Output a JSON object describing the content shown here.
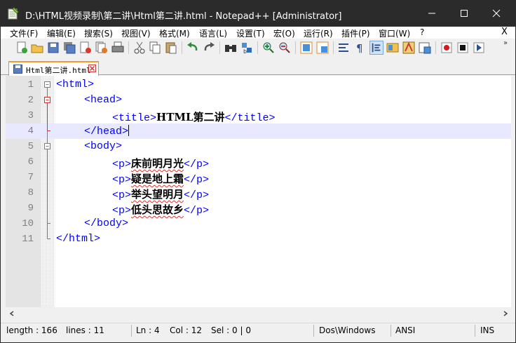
{
  "window": {
    "title": "D:\\HTML视频录制\\第二讲\\Html第二讲.html - Notepad++ [Administrator]"
  },
  "menu": {
    "items": [
      {
        "label": "文件(F)"
      },
      {
        "label": "编辑(E)"
      },
      {
        "label": "搜索(S)"
      },
      {
        "label": "视图(V)"
      },
      {
        "label": "格式(M)"
      },
      {
        "label": "语言(L)"
      },
      {
        "label": "设置(T)"
      },
      {
        "label": "宏(O)"
      },
      {
        "label": "运行(R)"
      },
      {
        "label": "插件(P)"
      },
      {
        "label": "窗口(W)"
      },
      {
        "label": "?"
      }
    ],
    "close_label": "X"
  },
  "toolbar": {
    "buttons": [
      "new-file-icon",
      "open-file-icon",
      "save-icon",
      "save-all-icon",
      "close-icon",
      "close-all-icon",
      "print-icon",
      "cut-icon",
      "copy-icon",
      "paste-icon",
      "undo-icon",
      "redo-icon",
      "find-icon",
      "replace-icon",
      "zoom-in-icon",
      "zoom-out-icon",
      "sync-vertical-icon",
      "sync-horizontal-icon",
      "word-wrap-icon",
      "show-all-characters-icon",
      "indent-guide-icon",
      "document-map-icon",
      "function-list-icon",
      "folder-as-workspace-icon",
      "record-macro-icon",
      "stop-macro-icon",
      "play-macro-icon"
    ],
    "more_label": "»"
  },
  "tab": {
    "label": "Html第二讲.html"
  },
  "editor": {
    "current_line": 4,
    "lines": [
      {
        "n": "1",
        "tokens": [
          {
            "t": "<html>",
            "c": "tag"
          }
        ]
      },
      {
        "n": "2",
        "tokens": [
          {
            "t": "<head>",
            "c": "tag"
          }
        ]
      },
      {
        "n": "3",
        "tokens": [
          {
            "t": "<title>",
            "c": "tag"
          },
          {
            "t": "HTML第二讲",
            "c": "txt"
          },
          {
            "t": "</title>",
            "c": "tag"
          }
        ]
      },
      {
        "n": "4",
        "tokens": [
          {
            "t": "</head>",
            "c": "tag"
          }
        ]
      },
      {
        "n": "5",
        "tokens": [
          {
            "t": "<body>",
            "c": "tag"
          }
        ]
      },
      {
        "n": "6",
        "tokens": [
          {
            "t": "<p>",
            "c": "tag"
          },
          {
            "t": "床前明月光",
            "c": "txt"
          },
          {
            "t": "</p>",
            "c": "tag"
          }
        ]
      },
      {
        "n": "7",
        "tokens": [
          {
            "t": "<p>",
            "c": "tag"
          },
          {
            "t": "疑是地上霜",
            "c": "txt"
          },
          {
            "t": "</p>",
            "c": "tag"
          }
        ]
      },
      {
        "n": "8",
        "tokens": [
          {
            "t": "<p>",
            "c": "tag"
          },
          {
            "t": "举头望明月",
            "c": "txt"
          },
          {
            "t": "</p>",
            "c": "tag"
          }
        ]
      },
      {
        "n": "9",
        "tokens": [
          {
            "t": "<p>",
            "c": "tag"
          },
          {
            "t": "低头思故乡",
            "c": "txt"
          },
          {
            "t": "</p>",
            "c": "tag"
          }
        ]
      },
      {
        "n": "10",
        "tokens": [
          {
            "t": "</body>",
            "c": "tag"
          }
        ]
      },
      {
        "n": "11",
        "tokens": [
          {
            "t": "</html>",
            "c": "tag"
          }
        ]
      }
    ]
  },
  "statusbar": {
    "length": "length : 166",
    "lines": "lines : 11",
    "ln": "Ln : 4",
    "col": "Col : 12",
    "sel": "Sel : 0 | 0",
    "eol": "Dos\\Windows",
    "encoding": "ANSI",
    "mode": "INS"
  },
  "colors": {
    "titlebar": "#2b2b2b",
    "tag": "#0000ff",
    "current_line": "#e8e8ff",
    "fold_active": "#e03030",
    "tab_accent": "#f89a2c"
  }
}
